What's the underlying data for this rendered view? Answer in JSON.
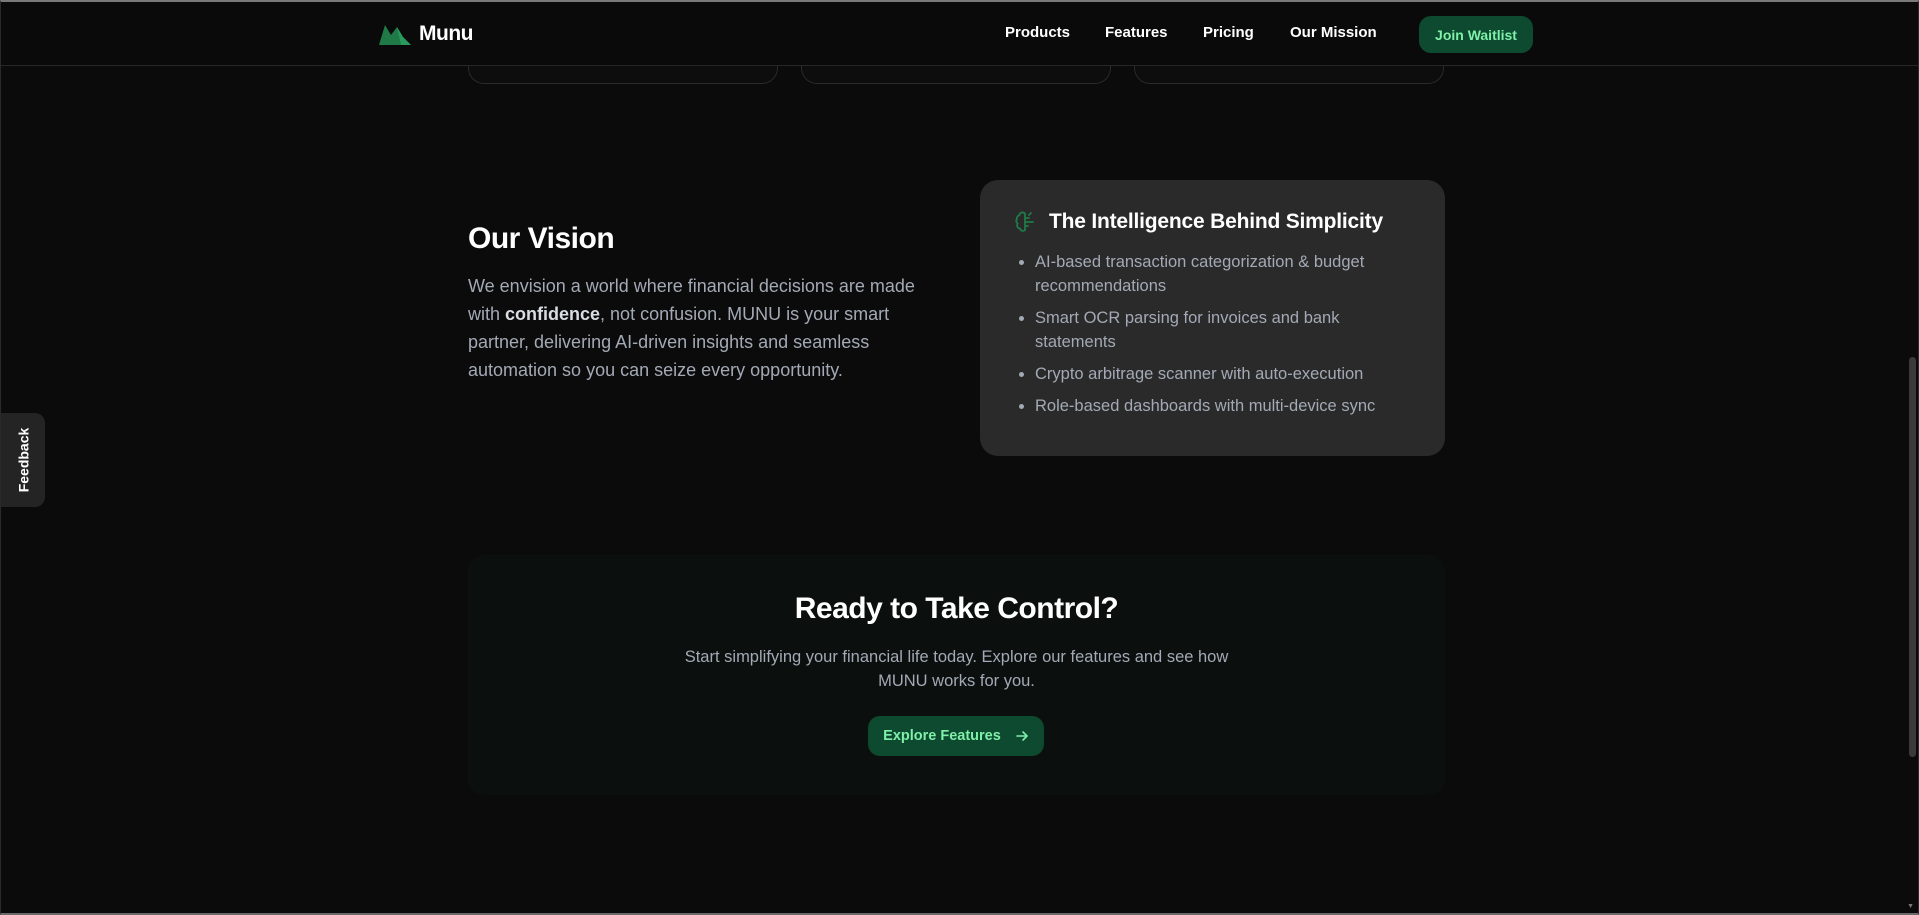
{
  "header": {
    "brand": "Munu",
    "nav": [
      "Products",
      "Features",
      "Pricing",
      "Our Mission"
    ],
    "cta_label": "Join Waitlist"
  },
  "vision": {
    "title": "Our Vision",
    "text_before": "We envision a world where financial decisions are made with ",
    "text_bold": "confidence",
    "text_after": ", not confusion. MUNU is your smart partner, delivering AI-driven insights and seamless automation so you can seize every opportunity."
  },
  "intelligence": {
    "title": "The Intelligence Behind Simplicity",
    "icon": "brain-icon",
    "items": [
      "AI-based transaction categorization & budget recommendations",
      "Smart OCR parsing for invoices and bank statements",
      "Crypto arbitrage scanner with auto-execution",
      "Role-based dashboards with multi-device sync"
    ]
  },
  "feedback": {
    "label": "Feedback"
  },
  "cta": {
    "title": "Ready to Take Control?",
    "text": "Start simplifying your financial life today. Explore our features and see how MUNU works for you.",
    "button_label": "Explore Features",
    "button_icon": "arrow-right-icon"
  },
  "colors": {
    "background": "#0b0b0b",
    "accent": "#0d4a30",
    "accent_text": "#7ff0a8",
    "card": "#2a2a2a",
    "muted_text": "#a3a9b5"
  }
}
